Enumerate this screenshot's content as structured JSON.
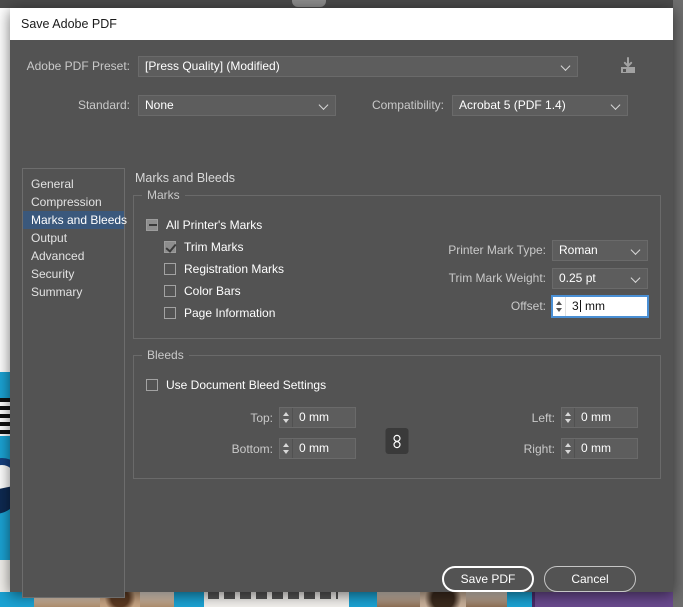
{
  "window": {
    "title": "Save Adobe PDF"
  },
  "preset": {
    "label": "Adobe PDF Preset:",
    "value": "[Press Quality] (Modified)",
    "save_icon": "save-preset-icon"
  },
  "standard": {
    "label": "Standard:",
    "value": "None"
  },
  "compatibility": {
    "label": "Compatibility:",
    "value": "Acrobat 5 (PDF 1.4)"
  },
  "sidebar": {
    "items": [
      {
        "label": "General",
        "active": false
      },
      {
        "label": "Compression",
        "active": false
      },
      {
        "label": "Marks and Bleeds",
        "active": true
      },
      {
        "label": "Output",
        "active": false
      },
      {
        "label": "Advanced",
        "active": false
      },
      {
        "label": "Security",
        "active": false
      },
      {
        "label": "Summary",
        "active": false
      }
    ]
  },
  "pane": {
    "title": "Marks and Bleeds"
  },
  "marks": {
    "group_label": "Marks",
    "all_printers_marks": {
      "label": "All Printer's Marks",
      "state": "indeterminate"
    },
    "checkboxes": [
      {
        "label": "Trim Marks",
        "state": "checked"
      },
      {
        "label": "Registration Marks",
        "state": "unchecked"
      },
      {
        "label": "Color Bars",
        "state": "unchecked"
      },
      {
        "label": "Page Information",
        "state": "unchecked"
      }
    ],
    "printer_mark_type": {
      "label": "Printer Mark Type:",
      "value": "Roman"
    },
    "trim_mark_weight": {
      "label": "Trim Mark Weight:",
      "value": "0.25 pt"
    },
    "offset": {
      "label": "Offset:",
      "value": "3",
      "unit": "mm",
      "focused": true
    }
  },
  "bleeds": {
    "group_label": "Bleeds",
    "use_document_bleed": {
      "label": "Use Document Bleed Settings",
      "state": "unchecked"
    },
    "link_icon": "chain-link-icon",
    "fields": [
      {
        "name": "top",
        "label": "Top:",
        "value": "0 mm"
      },
      {
        "name": "bottom",
        "label": "Bottom:",
        "value": "0 mm"
      },
      {
        "name": "left",
        "label": "Left:",
        "value": "0 mm"
      },
      {
        "name": "right",
        "label": "Right:",
        "value": "0 mm"
      }
    ]
  },
  "footer": {
    "save_label": "Save PDF",
    "cancel_label": "Cancel"
  },
  "colors": {
    "dialog_bg": "#535353",
    "titlebar_bg": "#ffffff",
    "accent_selection": "#3a587c",
    "focus_border": "#4a8fd4",
    "field_bg": "#5d5d5d",
    "bg_cyan": "#1ba3d4"
  }
}
